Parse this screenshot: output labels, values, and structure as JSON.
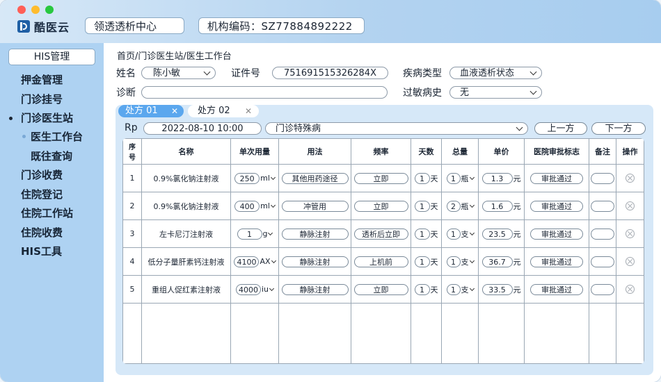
{
  "header": {
    "logo_text": "酷医云",
    "center_name": "领透透析中心",
    "org_code": "机构编码：SZ77884892222"
  },
  "sidebar": {
    "title": "HIS管理",
    "items": [
      {
        "label": "押金管理"
      },
      {
        "label": "门诊挂号"
      },
      {
        "label": "门诊医生站"
      },
      {
        "label": "医生工作台"
      },
      {
        "label": "既往查询"
      },
      {
        "label": "门诊收费"
      },
      {
        "label": "住院登记"
      },
      {
        "label": "住院工作站"
      },
      {
        "label": "住院收费"
      },
      {
        "label": "HIS工具"
      }
    ]
  },
  "main": {
    "breadcrumb": "首页/门诊医生站/医生工作台",
    "patient": {
      "name_label": "姓名",
      "name_value": "陈小敏",
      "id_label": "证件号",
      "id_value": "751691515326284X",
      "disease_label": "疾病类型",
      "disease_value": "血液透析状态",
      "diagnosis_label": "诊断",
      "diagnosis_value": "",
      "allergy_label": "过敏病史",
      "allergy_value": "无"
    },
    "tabs": [
      {
        "label": "处方 01",
        "close": "✕"
      },
      {
        "label": "处方 02",
        "close": "✕"
      }
    ],
    "rp": {
      "label": "Rp",
      "datetime": "2022-08-10 10:00",
      "type": "门诊特殊病",
      "prev": "上一方",
      "next": "下一方"
    },
    "table": {
      "headers": [
        "序号",
        "名称",
        "单次用量",
        "用法",
        "频率",
        "天数",
        "总量",
        "单价",
        "医院审批标志",
        "备注",
        "操作"
      ],
      "rows": [
        {
          "no": "1",
          "name": "0.9%氯化钠注射液",
          "dose": "250",
          "dose_unit": "ml",
          "usage": "其他用药途径",
          "freq": "立即",
          "days": "1",
          "days_unit": "天",
          "total": "1",
          "total_unit": "瓶",
          "price": "1.3",
          "price_unit": "元",
          "approval": "审批通过",
          "note": ""
        },
        {
          "no": "2",
          "name": "0.9%氯化钠注射液",
          "dose": "400",
          "dose_unit": "ml",
          "usage": "冲管用",
          "freq": "立即",
          "days": "1",
          "days_unit": "天",
          "total": "2",
          "total_unit": "瓶",
          "price": "1.6",
          "price_unit": "元",
          "approval": "审批通过",
          "note": ""
        },
        {
          "no": "3",
          "name": "左卡尼汀注射液",
          "dose": "1",
          "dose_unit": "g",
          "usage": "静脉注射",
          "freq": "透析后立即",
          "days": "1",
          "days_unit": "天",
          "total": "1",
          "total_unit": "支",
          "price": "23.5",
          "price_unit": "元",
          "approval": "审批通过",
          "note": ""
        },
        {
          "no": "4",
          "name": "低分子量肝素钙注射液",
          "dose": "4100",
          "dose_unit": "AX",
          "usage": "静脉注射",
          "freq": "上机前",
          "days": "1",
          "days_unit": "天",
          "total": "1",
          "total_unit": "支",
          "price": "36.7",
          "price_unit": "元",
          "approval": "审批通过",
          "note": ""
        },
        {
          "no": "5",
          "name": "重组人促红素注射液",
          "dose": "4000",
          "dose_unit": "iu",
          "usage": "静脉注射",
          "freq": "立即",
          "days": "1",
          "days_unit": "天",
          "total": "1",
          "total_unit": "支",
          "price": "33.5",
          "price_unit": "元",
          "approval": "审批通过",
          "note": ""
        }
      ]
    }
  },
  "colors": {
    "sidebar_bg": "#aed2f2",
    "tab_active": "#5ba7ee",
    "panel_bg": "#d6e8f8",
    "bullet": "#1b2533",
    "sub_bullet": "#7aa8d6"
  },
  "icons": {
    "close_tab": "close-icon",
    "delete_row": "delete-circle-icon",
    "dropdown": "chevron-down-icon"
  }
}
